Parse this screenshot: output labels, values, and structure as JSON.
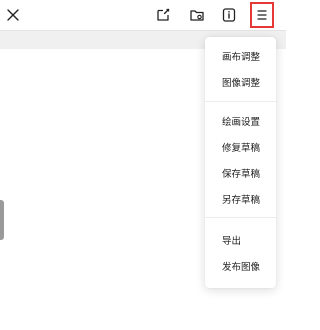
{
  "toolbar": {
    "icons": [
      "close-icon",
      "note-edit-icon",
      "folder-icon",
      "info-icon",
      "menu-icon"
    ]
  },
  "menu": {
    "group1": [
      "画布调整",
      "图像调整"
    ],
    "group2": [
      "绘画设置",
      "修复草稿",
      "保存草稿",
      "另存草稿"
    ],
    "group3": [
      "导出",
      "发布图像"
    ]
  },
  "colors": {
    "highlight": "#e53935",
    "toolbar_stripe": "#f0f0f0",
    "side_handle": "#9a9a9a"
  }
}
